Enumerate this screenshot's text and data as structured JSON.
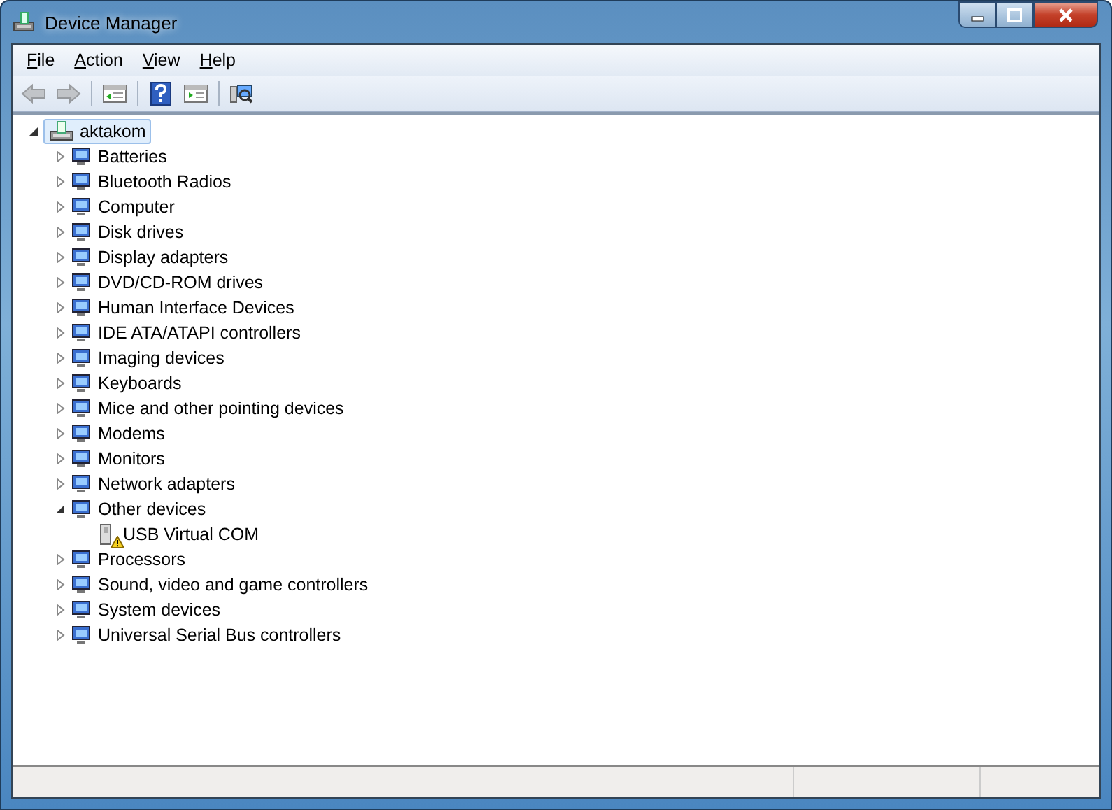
{
  "window": {
    "title": "Device Manager"
  },
  "menu": [
    "File",
    "Action",
    "View",
    "Help"
  ],
  "toolbar": [
    {
      "kind": "back",
      "disabled": true
    },
    {
      "kind": "forward",
      "disabled": true
    },
    {
      "kind": "sep"
    },
    {
      "kind": "console",
      "disabled": false
    },
    {
      "kind": "sep"
    },
    {
      "kind": "help",
      "disabled": false
    },
    {
      "kind": "properties",
      "disabled": false
    },
    {
      "kind": "sep"
    },
    {
      "kind": "scan",
      "disabled": false
    }
  ],
  "tree": {
    "label": "aktakom",
    "expanded": true,
    "selected": true,
    "children": [
      {
        "label": "Batteries",
        "expanded": false
      },
      {
        "label": "Bluetooth Radios",
        "expanded": false
      },
      {
        "label": "Computer",
        "expanded": false
      },
      {
        "label": "Disk drives",
        "expanded": false
      },
      {
        "label": "Display adapters",
        "expanded": false
      },
      {
        "label": "DVD/CD-ROM drives",
        "expanded": false
      },
      {
        "label": "Human Interface Devices",
        "expanded": false
      },
      {
        "label": "IDE ATA/ATAPI controllers",
        "expanded": false
      },
      {
        "label": "Imaging devices",
        "expanded": false
      },
      {
        "label": "Keyboards",
        "expanded": false
      },
      {
        "label": "Mice and other pointing devices",
        "expanded": false
      },
      {
        "label": "Modems",
        "expanded": false
      },
      {
        "label": "Monitors",
        "expanded": false
      },
      {
        "label": "Network adapters",
        "expanded": false
      },
      {
        "label": "Other devices",
        "expanded": true,
        "children": [
          {
            "label": "USB Virtual COM",
            "warning": true
          }
        ]
      },
      {
        "label": "Processors",
        "expanded": false
      },
      {
        "label": "Sound, video and game controllers",
        "expanded": false
      },
      {
        "label": "System devices",
        "expanded": false
      },
      {
        "label": "Universal Serial Bus controllers",
        "expanded": false
      }
    ]
  }
}
